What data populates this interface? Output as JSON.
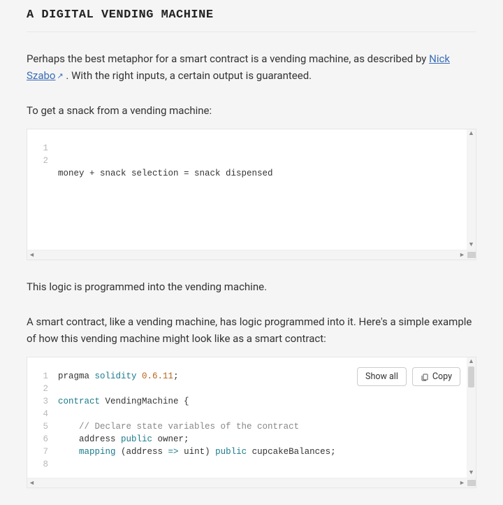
{
  "heading": "A DIGITAL VENDING MACHINE",
  "intro": {
    "before_link": "Perhaps the best metaphor for a smart contract is a vending machine, as described by ",
    "link_text": "Nick Szabo",
    "after_link": " . With the right inputs, a certain output is guaranteed."
  },
  "para2": "To get a snack from a vending machine:",
  "para3": "This logic is programmed into the vending machine.",
  "para4": "A smart contract, like a vending machine, has logic programmed into it. Here's a simple example of how this vending machine might look like as a smart contract:",
  "code1": {
    "lines": [
      {
        "num": "1",
        "text": "money + snack selection = snack dispensed"
      },
      {
        "num": "2",
        "text": ""
      }
    ]
  },
  "code2": {
    "buttons": {
      "show_all": "Show all",
      "copy": "Copy"
    },
    "lines": [
      {
        "num": "1",
        "tokens": [
          [
            "",
            "pragma "
          ],
          [
            "kw",
            "solidity"
          ],
          [
            "",
            " "
          ],
          [
            "num",
            "0.6.11"
          ],
          [
            "",
            ";"
          ]
        ]
      },
      {
        "num": "2",
        "tokens": [
          [
            "",
            ""
          ]
        ]
      },
      {
        "num": "3",
        "tokens": [
          [
            "kw",
            "contract"
          ],
          [
            "",
            " VendingMachine {"
          ]
        ]
      },
      {
        "num": "4",
        "tokens": [
          [
            "",
            ""
          ]
        ]
      },
      {
        "num": "5",
        "tokens": [
          [
            "",
            "    "
          ],
          [
            "cmt",
            "// Declare state variables of the contract"
          ]
        ]
      },
      {
        "num": "6",
        "tokens": [
          [
            "",
            "    address "
          ],
          [
            "kw",
            "public"
          ],
          [
            "",
            " owner;"
          ]
        ]
      },
      {
        "num": "7",
        "tokens": [
          [
            "",
            "    "
          ],
          [
            "kw",
            "mapping"
          ],
          [
            "",
            " (address "
          ],
          [
            "kw",
            "=>"
          ],
          [
            "",
            " uint) "
          ],
          [
            "kw",
            "public"
          ],
          [
            "",
            " cupcakeBalances;"
          ]
        ]
      },
      {
        "num": "8",
        "tokens": [
          [
            "",
            ""
          ]
        ]
      }
    ]
  }
}
